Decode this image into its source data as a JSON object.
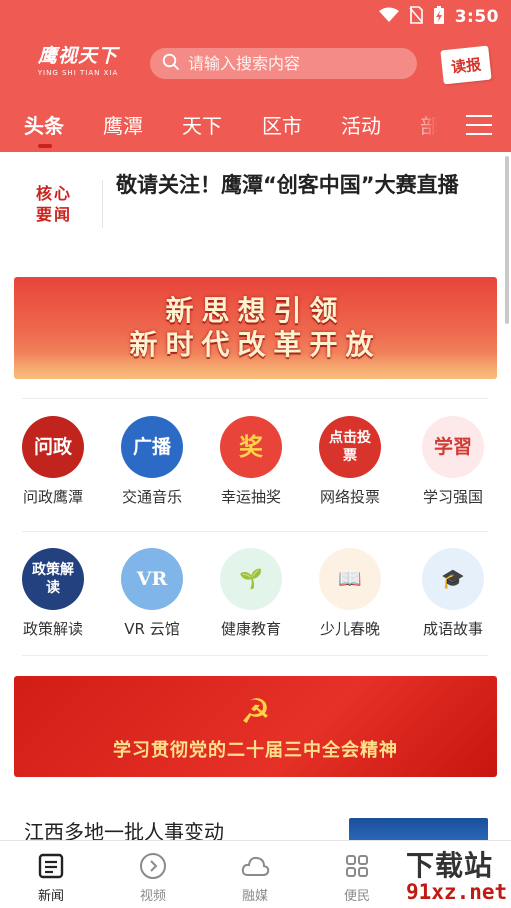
{
  "status_bar": {
    "time": "3:50"
  },
  "header": {
    "logo_cn": "鹰视天下",
    "logo_en": "YING SHI TIAN XIA",
    "search_placeholder": "请输入搜索内容",
    "read_paper_label": "读报"
  },
  "tabs": [
    "头条",
    "鹰潭",
    "天下",
    "区市",
    "活动",
    "部"
  ],
  "headline": {
    "badge_line1": "核心",
    "badge_line2": "要闻",
    "title": "敬请关注！鹰潭“创客中国”大赛直播"
  },
  "banner_top": {
    "line1": "新思想引领",
    "line2": "新时代改革开放"
  },
  "services_row1": [
    {
      "label": "问政鹰潭",
      "icon": "wenzheng-icon",
      "glyph": "问政",
      "bg": "#c0241d",
      "fg": "#ffffff"
    },
    {
      "label": "交通音乐",
      "icon": "traffic-music-icon",
      "glyph": "广播",
      "bg": "#2c6bc5",
      "fg": "#ffffff"
    },
    {
      "label": "幸运抽奖",
      "icon": "lottery-icon",
      "glyph": "奖",
      "bg": "#e9443a",
      "fg": "#ffd24a"
    },
    {
      "label": "网络投票",
      "icon": "vote-icon",
      "glyph": "点击投票",
      "bg": "#d9342b",
      "fg": "#ffffff"
    },
    {
      "label": "学习强国",
      "icon": "xuexi-icon",
      "glyph": "学習",
      "bg": "#fde9ea",
      "fg": "#d23b33"
    }
  ],
  "services_row2": [
    {
      "label": "政策解读",
      "icon": "policy-icon",
      "glyph": "政策解读",
      "bg": "#23407f",
      "fg": "#ffffff"
    },
    {
      "label": "VR 云馆",
      "icon": "vr-icon",
      "glyph": "VR",
      "bg": "#7fb5e8",
      "fg": "#ffffff"
    },
    {
      "label": "健康教育",
      "icon": "sprout-icon",
      "glyph": "🌱",
      "bg": "#e3f5ea",
      "fg": "#3aa35b"
    },
    {
      "label": "少儿春晚",
      "icon": "book-icon",
      "glyph": "📖",
      "bg": "#fdf1e3",
      "fg": "#f08a2a"
    },
    {
      "label": "成语故事",
      "icon": "graduation-cap-icon",
      "glyph": "🎓",
      "bg": "#e6f0fb",
      "fg": "#3c7fd1"
    }
  ],
  "banner_party": {
    "emblem": "☭",
    "slogan": "学习贯彻党的二十届三中全会精神"
  },
  "news_item": {
    "title": "江西多地一批人事变动"
  },
  "bottom_nav": [
    {
      "label": "新闻",
      "icon": "news-icon",
      "active": true
    },
    {
      "label": "视频",
      "icon": "video-icon",
      "active": false
    },
    {
      "label": "融媒",
      "icon": "cloud-icon",
      "active": false
    },
    {
      "label": "便民",
      "icon": "service-icon",
      "active": false
    }
  ],
  "watermark": {
    "top": "下载站",
    "bottom": "91xz.net"
  }
}
